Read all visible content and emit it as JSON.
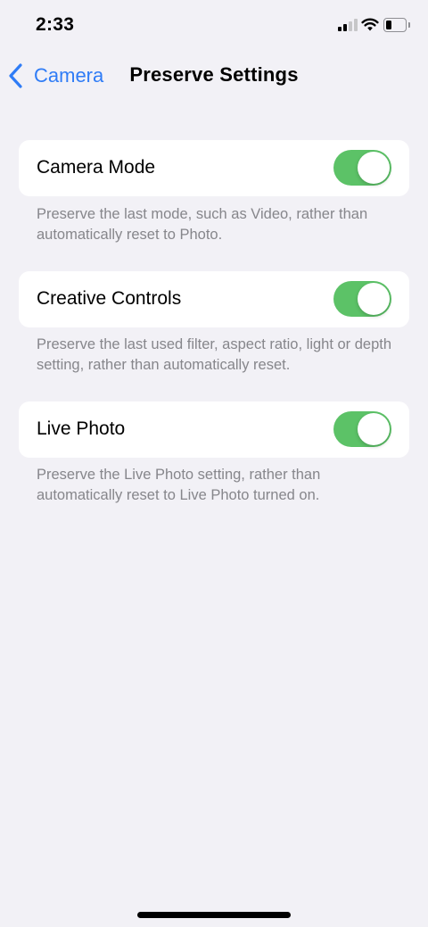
{
  "status_bar": {
    "time": "2:33"
  },
  "nav": {
    "back_label": "Camera",
    "title": "Preserve Settings"
  },
  "settings": [
    {
      "label": "Camera Mode",
      "enabled": true,
      "footnote": "Preserve the last mode, such as Video, rather than automatically reset to Photo."
    },
    {
      "label": "Creative Controls",
      "enabled": true,
      "footnote": "Preserve the last used filter, aspect ratio, light or depth setting, rather than automatically reset."
    },
    {
      "label": "Live Photo",
      "enabled": true,
      "footnote": "Preserve the Live Photo setting, rather than automatically reset to Live Photo turned on."
    }
  ],
  "colors": {
    "accent": "#2f7cf6",
    "toggle_on": "#5cc267",
    "background": "#f2f1f6",
    "footnote": "#86868b"
  }
}
